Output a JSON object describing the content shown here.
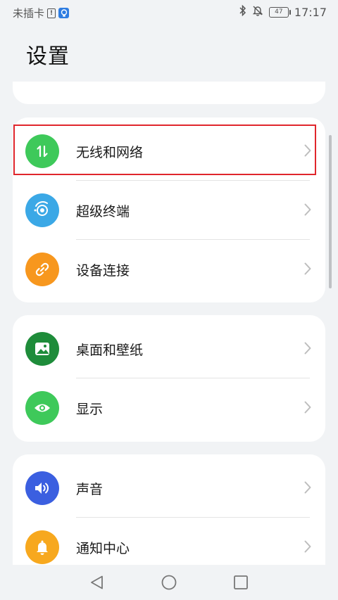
{
  "status_bar": {
    "sim_status": "未插卡",
    "battery_level": "47",
    "time": "17:17",
    "icons": [
      "alert-icon",
      "bulb-icon",
      "bluetooth-icon",
      "mute-bell-icon",
      "battery-icon"
    ]
  },
  "header": {
    "title": "设置"
  },
  "groups": [
    {
      "items": [
        {
          "label": "无线和网络",
          "icon": "swap-arrows-icon",
          "color": "#3ec95a",
          "highlighted": true
        },
        {
          "label": "超级终端",
          "icon": "super-device-icon",
          "color": "#3ba8e6"
        },
        {
          "label": "设备连接",
          "icon": "link-icon",
          "color": "#f7971e"
        }
      ]
    },
    {
      "items": [
        {
          "label": "桌面和壁纸",
          "icon": "wallpaper-icon",
          "color": "#1e8c3a"
        },
        {
          "label": "显示",
          "icon": "eye-icon",
          "color": "#3ec95a"
        }
      ]
    },
    {
      "items": [
        {
          "label": "声音",
          "icon": "speaker-icon",
          "color": "#3b5fe0"
        },
        {
          "label": "通知中心",
          "icon": "bell-icon",
          "color": "#f7a81e"
        }
      ]
    }
  ],
  "colors": {
    "background": "#f1f3f5",
    "card": "#ffffff",
    "highlight_border": "#e0262c"
  },
  "nav_bar": {
    "buttons": [
      "back-icon",
      "home-icon",
      "recents-icon"
    ]
  }
}
